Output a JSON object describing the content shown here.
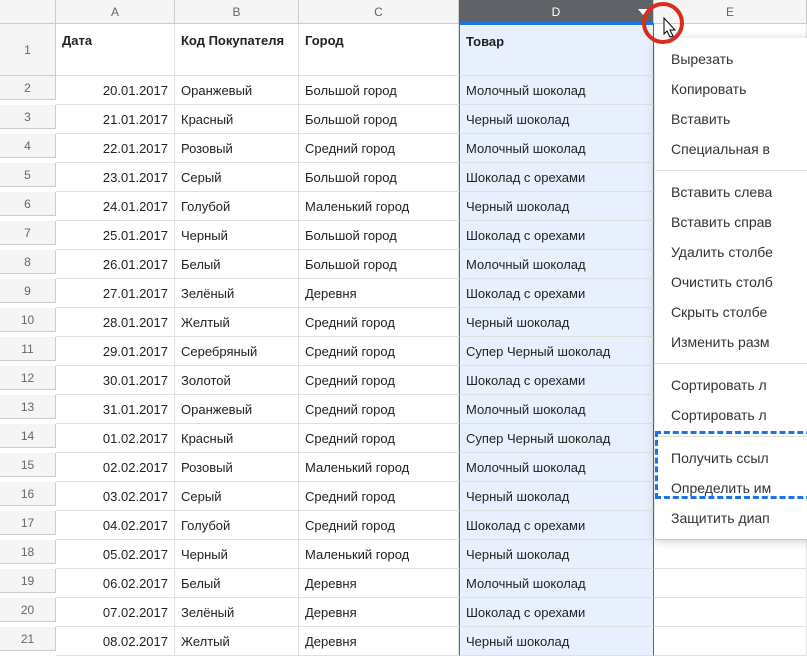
{
  "colHeaders": [
    "A",
    "B",
    "C",
    "D",
    "E"
  ],
  "selectedCol": "D",
  "headers": {
    "A": "Дата",
    "B": "Код Покупателя",
    "C": "Город",
    "D": "Товар",
    "E": ""
  },
  "rows": [
    {
      "n": 2,
      "A": "20.01.2017",
      "B": "Оранжевый",
      "C": "Большой город",
      "D": "Молочный шоколад"
    },
    {
      "n": 3,
      "A": "21.01.2017",
      "B": "Красный",
      "C": "Большой город",
      "D": "Черный шоколад"
    },
    {
      "n": 4,
      "A": "22.01.2017",
      "B": "Розовый",
      "C": "Средний город",
      "D": "Молочный шоколад"
    },
    {
      "n": 5,
      "A": "23.01.2017",
      "B": "Серый",
      "C": "Большой город",
      "D": "Шоколад с орехами"
    },
    {
      "n": 6,
      "A": "24.01.2017",
      "B": "Голубой",
      "C": "Маленький город",
      "D": "Черный шоколад"
    },
    {
      "n": 7,
      "A": "25.01.2017",
      "B": "Черный",
      "C": "Большой город",
      "D": "Шоколад с орехами"
    },
    {
      "n": 8,
      "A": "26.01.2017",
      "B": "Белый",
      "C": "Большой город",
      "D": "Молочный шоколад"
    },
    {
      "n": 9,
      "A": "27.01.2017",
      "B": "Зелёный",
      "C": "Деревня",
      "D": "Шоколад с орехами"
    },
    {
      "n": 10,
      "A": "28.01.2017",
      "B": "Желтый",
      "C": "Средний город",
      "D": "Черный шоколад"
    },
    {
      "n": 11,
      "A": "29.01.2017",
      "B": "Серебряный",
      "C": "Средний город",
      "D": "Супер Черный шоколад"
    },
    {
      "n": 12,
      "A": "30.01.2017",
      "B": "Золотой",
      "C": "Средний город",
      "D": "Шоколад с орехами"
    },
    {
      "n": 13,
      "A": "31.01.2017",
      "B": "Оранжевый",
      "C": "Средний город",
      "D": "Молочный шоколад"
    },
    {
      "n": 14,
      "A": "01.02.2017",
      "B": "Красный",
      "C": "Средний город",
      "D": "Супер Черный шоколад"
    },
    {
      "n": 15,
      "A": "02.02.2017",
      "B": "Розовый",
      "C": "Маленький город",
      "D": "Молочный шоколад"
    },
    {
      "n": 16,
      "A": "03.02.2017",
      "B": "Серый",
      "C": "Средний город",
      "D": "Черный шоколад"
    },
    {
      "n": 17,
      "A": "04.02.2017",
      "B": "Голубой",
      "C": "Средний город",
      "D": "Шоколад с орехами"
    },
    {
      "n": 18,
      "A": "05.02.2017",
      "B": "Черный",
      "C": "Маленький город",
      "D": "Черный шоколад"
    },
    {
      "n": 19,
      "A": "06.02.2017",
      "B": "Белый",
      "C": "Деревня",
      "D": "Молочный шоколад"
    },
    {
      "n": 20,
      "A": "07.02.2017",
      "B": "Зелёный",
      "C": "Деревня",
      "D": "Шоколад с орехами"
    },
    {
      "n": 21,
      "A": "08.02.2017",
      "B": "Желтый",
      "C": "Деревня",
      "D": "Черный шоколад"
    }
  ],
  "contextMenu": {
    "groups": [
      [
        "Вырезать",
        "Копировать",
        "Вставить",
        "Специальная в"
      ],
      [
        "Вставить слева",
        "Вставить справ",
        "Удалить столбе",
        "Очистить столб",
        "Скрыть столбе",
        "Изменить разм"
      ],
      [
        "Сортировать л",
        "Сортировать л"
      ],
      [
        "Получить ссыл",
        "Определить им",
        "Защитить диап"
      ]
    ]
  }
}
